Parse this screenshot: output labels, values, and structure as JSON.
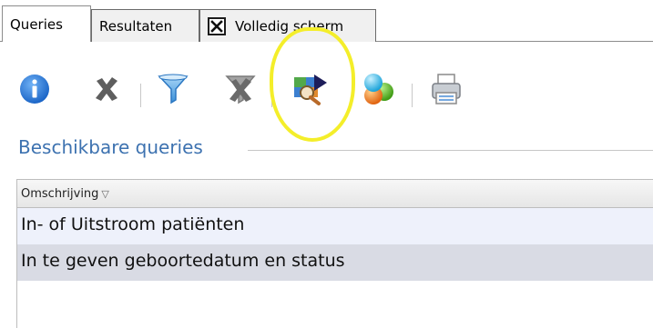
{
  "tabs": [
    {
      "label": "Queries",
      "active": true
    },
    {
      "label": "Resultaten",
      "active": false
    },
    {
      "label": "Volledig scherm",
      "active": false,
      "icon": "close-x-icon"
    }
  ],
  "toolbar": {
    "buttons": [
      {
        "name": "info",
        "icon": "info-icon"
      },
      {
        "name": "delete",
        "icon": "close-x-icon"
      },
      {
        "name": "filter",
        "icon": "filter-icon"
      },
      {
        "name": "remove-filter",
        "icon": "filter-remove-icon"
      },
      {
        "name": "run-query",
        "icon": "run-query-icon",
        "highlighted": true
      },
      {
        "name": "colors",
        "icon": "color-balls-icon"
      },
      {
        "name": "print",
        "icon": "printer-icon"
      }
    ],
    "highlight_color": "#f4ee2a"
  },
  "section": {
    "title": "Beschikbare queries"
  },
  "grid": {
    "column_header": "Omschrijving",
    "sort_indicator": "▽",
    "rows": [
      {
        "label": "In- of Uitstroom patiënten"
      },
      {
        "label": "In te geven geboortedatum en status"
      }
    ]
  },
  "colors": {
    "accent": "#3d72b0",
    "selected_row": "#d9dbe4",
    "row": "#eef1fb"
  }
}
